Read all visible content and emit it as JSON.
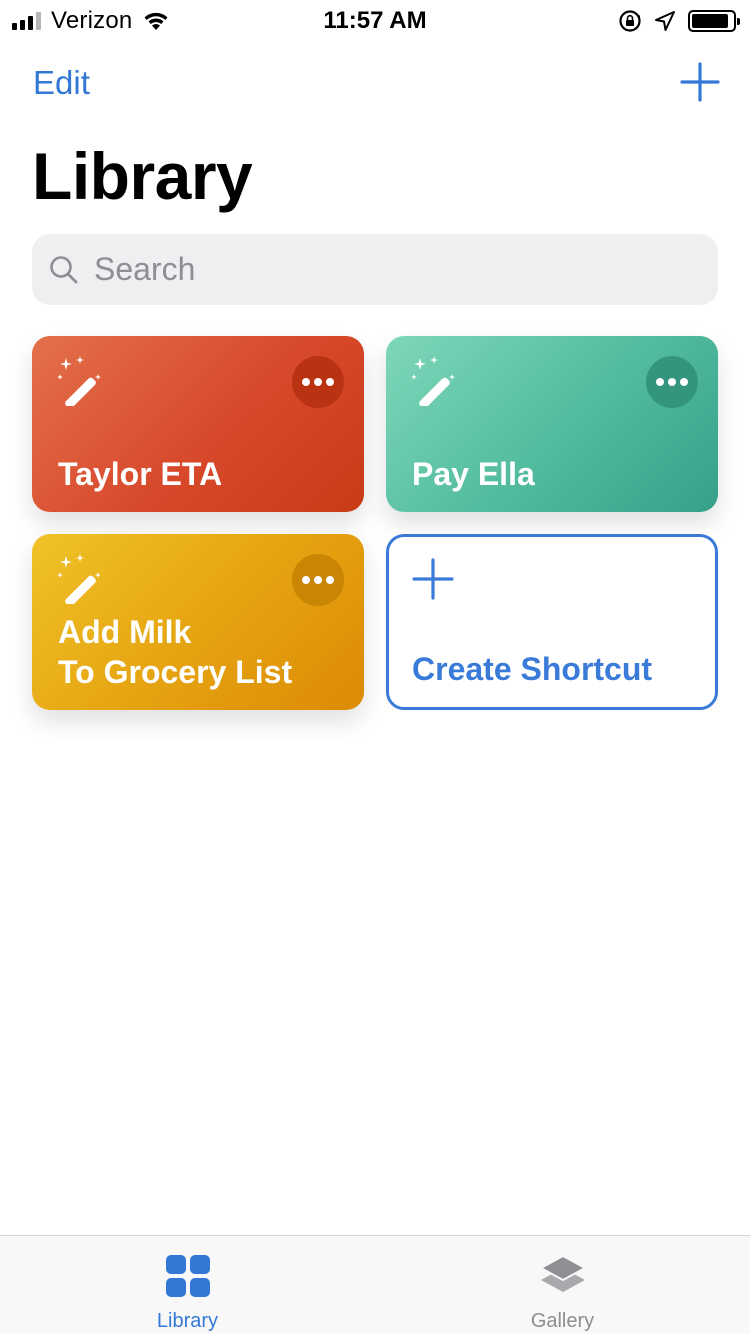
{
  "status_bar": {
    "carrier": "Verizon",
    "time": "11:57 AM",
    "signal_bars": 4,
    "signal_bars_filled": 3,
    "battery_level": 0.9,
    "icons": [
      "wifi-icon",
      "orientation-lock-icon",
      "location-arrow-icon",
      "battery-icon"
    ]
  },
  "nav": {
    "edit_label": "Edit",
    "add_icon": "plus-icon"
  },
  "page_title": "Library",
  "search": {
    "placeholder": "Search",
    "value": "",
    "icon": "search-icon"
  },
  "shortcuts": [
    {
      "title": "Taylor ETA",
      "color": "#d8492b",
      "icon": "magic-wand-icon",
      "menu_icon": "more-icon"
    },
    {
      "title": "Pay Ella",
      "color": "#55bda0",
      "icon": "magic-wand-icon",
      "menu_icon": "more-icon"
    },
    {
      "title_line1": "Add Milk",
      "title_line2": "To Grocery List",
      "color": "#e6a512",
      "icon": "magic-wand-icon",
      "menu_icon": "more-icon"
    }
  ],
  "create_shortcut": {
    "label": "Create Shortcut",
    "icon": "plus-icon",
    "color": "#3a7ad9"
  },
  "tab_bar": {
    "tabs": [
      {
        "label": "Library",
        "icon": "library-grid-icon",
        "active": true
      },
      {
        "label": "Gallery",
        "icon": "gallery-layers-icon",
        "active": false
      }
    ],
    "active_color": "#3478d6",
    "inactive_color": "#8e8e93"
  }
}
